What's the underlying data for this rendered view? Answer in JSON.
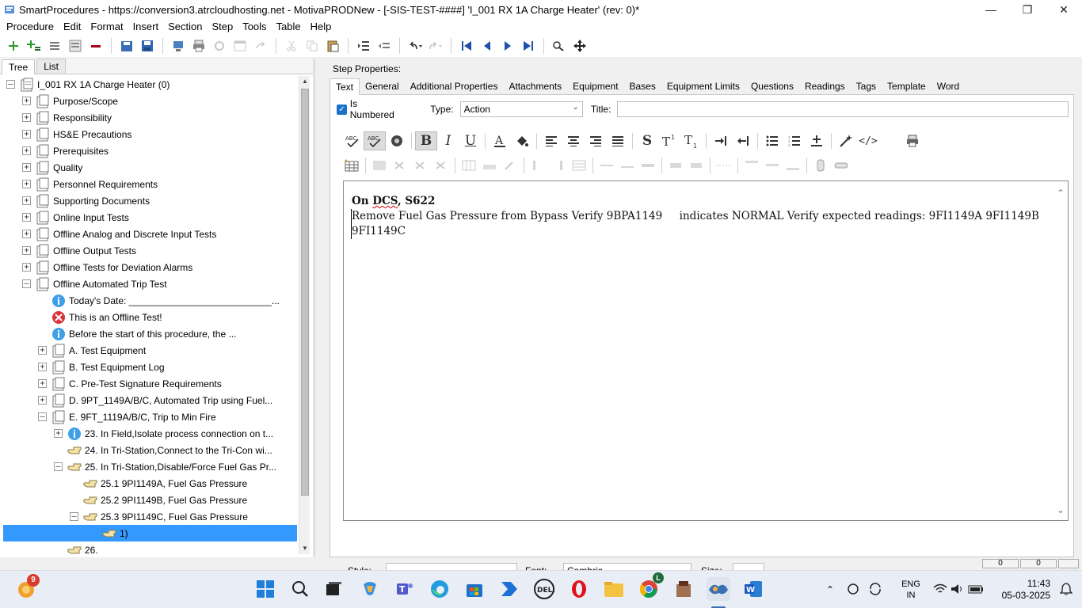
{
  "window": {
    "title": "SmartProcedures - https://conversion3.atrcloudhosting.net - MotivaPRODNew - [-SIS-TEST-####] 'I_001 RX 1A Charge Heater' (rev: 0)*"
  },
  "menu": [
    "Procedure",
    "Edit",
    "Format",
    "Insert",
    "Section",
    "Step",
    "Tools",
    "Table",
    "Help"
  ],
  "left_tabs": [
    "Tree",
    "List"
  ],
  "tree": {
    "root": "I_001 RX 1A Charge Heater (0)",
    "sections": [
      "Purpose/Scope",
      "Responsibility",
      "HS&E Precautions",
      "Prerequisites",
      "Quality",
      "Personnel Requirements",
      "Supporting Documents",
      "Online Input Tests",
      "Offline Analog and Discrete Input Tests",
      "Offline Output Tests",
      "Offline Tests for Deviation Alarms",
      "Offline Automated Trip Test"
    ],
    "trip_children": [
      "Today's Date: ___________________________...",
      "This is an Offline Test!",
      "Before the start of this procedure, the ...",
      "A. Test Equipment",
      "B. Test Equipment Log",
      "C. Pre-Test Signature Requirements",
      "D. 9PT_1149A/B/C, Automated Trip using Fuel...",
      "E. 9FT_1119A/B/C, Trip to Min Fire"
    ],
    "e_children": [
      "23. In Field,Isolate process connection on t...",
      "24. In Tri-Station,Connect to the Tri-Con wi...",
      "25. In Tri-Station,Disable/Force Fuel Gas Pr..."
    ],
    "step25_children": [
      "25.1 9PI1149A, Fuel Gas Pressure",
      "25.2 9PI1149B, Fuel Gas Pressure",
      "25.3 9PI1149C, Fuel Gas Pressure"
    ],
    "selected": "1)",
    "next": "26."
  },
  "step_properties": {
    "label": "Step Properties:",
    "tabs": [
      "Text",
      "General",
      "Additional Properties",
      "Attachments",
      "Equipment",
      "Bases",
      "Equipment Limits",
      "Questions",
      "Readings",
      "Tags",
      "Template",
      "Word"
    ],
    "is_numbered_label": "Is Numbered",
    "type_label": "Type:",
    "type_value": "Action",
    "title_label": "Title:",
    "title_value": ""
  },
  "editor": {
    "line1_pre": "On ",
    "line1_dcs": "DCS",
    "line1_post": ", S622",
    "body": "Remove Fuel Gas Pressure from Bypass Verify 9BPA1149     indicates NORMAL Verify expected readings: 9FI1149A 9FI1149B 9FI1149C"
  },
  "bottom": {
    "style_label": "Style:",
    "style_value": "",
    "font_label": "Font:",
    "font_value": "Cambria",
    "size_label": "Size:",
    "size_value": ""
  },
  "status": {
    "left": "0",
    "right": "0"
  },
  "taskbar": {
    "notification_count": "9",
    "chrome_badge": "L",
    "lang_line1": "ENG",
    "lang_line2": "IN",
    "time": "11:43",
    "date": "05-03-2025"
  },
  "colors": {
    "selection": "#3399ff",
    "accent": "#1a73c8"
  }
}
